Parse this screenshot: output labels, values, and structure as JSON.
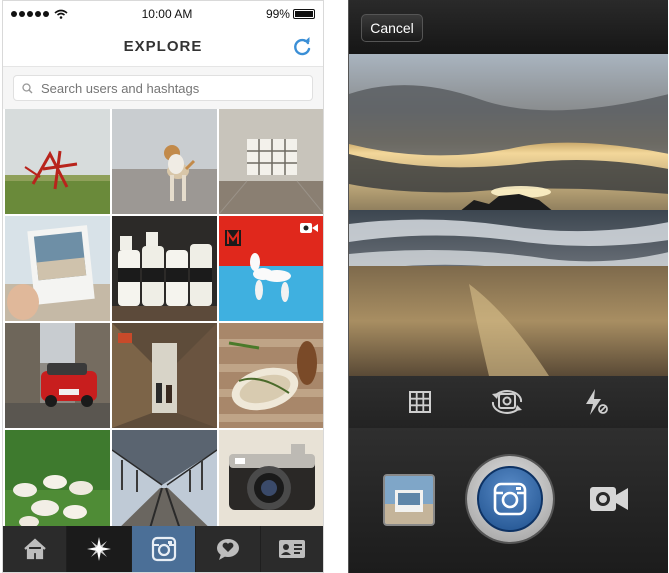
{
  "status": {
    "time": "10:00 AM",
    "battery": "99%",
    "battery_fill": 0.99
  },
  "explore": {
    "title": "EXPLORE",
    "search": {
      "placeholder": "Search users and hashtags",
      "value": ""
    }
  },
  "grid": [
    {
      "name": "photo-red-sculpture"
    },
    {
      "name": "photo-dog-beach"
    },
    {
      "name": "photo-empty-room"
    },
    {
      "name": "photo-polaroid"
    },
    {
      "name": "photo-milk-bottles"
    },
    {
      "name": "photo-balloon-dog",
      "video": true
    },
    {
      "name": "photo-red-car"
    },
    {
      "name": "photo-alley"
    },
    {
      "name": "photo-toast"
    },
    {
      "name": "photo-puppies"
    },
    {
      "name": "photo-train-station"
    },
    {
      "name": "photo-camera"
    }
  ],
  "tabs": [
    {
      "name": "home-icon",
      "active": false
    },
    {
      "name": "explore-icon",
      "active": true
    },
    {
      "name": "camera-icon",
      "active": false
    },
    {
      "name": "activity-icon",
      "active": false
    },
    {
      "name": "profile-icon",
      "active": false
    }
  ],
  "camera": {
    "cancel_label": "Cancel",
    "tools": [
      "grid-icon",
      "flip-camera-icon",
      "flash-off-icon"
    ]
  },
  "colors": {
    "accent": "#4b6f97",
    "refresh": "#3b8fd6",
    "shutter": "#2a64a8"
  }
}
